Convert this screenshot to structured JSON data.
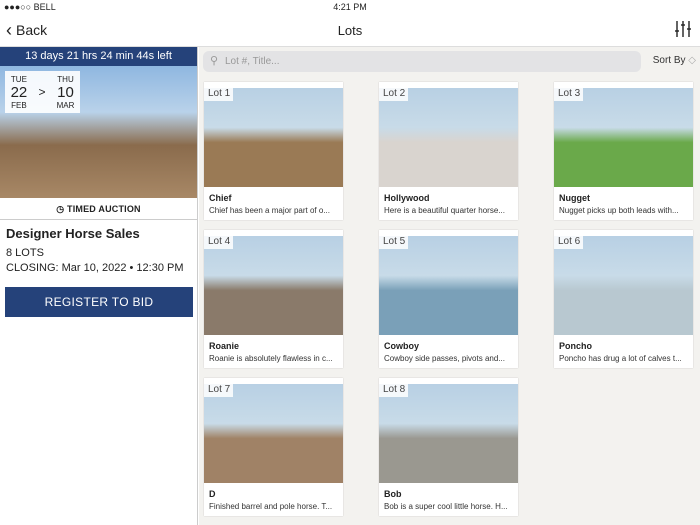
{
  "status": {
    "carrier": "●●●○○ BELL",
    "time": "4:21 PM"
  },
  "nav": {
    "back": "Back",
    "title": "Lots"
  },
  "auction": {
    "timer": "13 days 21 hrs 24 min 44s left",
    "start_day": "TUE",
    "start_date": "22",
    "start_month": "FEB",
    "sep": ">",
    "end_day": "THU",
    "end_date": "10",
    "end_month": "MAR",
    "type": "TIMED AUCTION",
    "title": "Designer Horse Sales",
    "lots": "8 LOTS",
    "closing": "CLOSING: Mar 10, 2022 • 12:30 PM",
    "register": "REGISTER TO BID"
  },
  "search": {
    "placeholder": "Lot #, Title...",
    "sort": "Sort By"
  },
  "lots": [
    {
      "lot": "Lot 1",
      "title": "Chief",
      "desc": "Chief has been a major part of o...",
      "color": "#9a7a55"
    },
    {
      "lot": "Lot 2",
      "title": "Hollywood",
      "desc": "Here is a beautiful quarter horse...",
      "color": "#d9d4cf"
    },
    {
      "lot": "Lot 3",
      "title": "Nugget",
      "desc": "Nugget picks up both leads with...",
      "color": "#6aa94a"
    },
    {
      "lot": "Lot 4",
      "title": "Roanie",
      "desc": "Roanie is absolutely flawless in c...",
      "color": "#8a7a6a"
    },
    {
      "lot": "Lot 5",
      "title": "Cowboy",
      "desc": "Cowboy side passes, pivots and...",
      "color": "#7aa0b8"
    },
    {
      "lot": "Lot 6",
      "title": "Poncho",
      "desc": "Poncho has drug a lot of calves t...",
      "color": "#b8c8d0"
    },
    {
      "lot": "Lot 7",
      "title": "D",
      "desc": "Finished barrel and pole horse. T...",
      "color": "#a08266"
    },
    {
      "lot": "Lot 8",
      "title": "Bob",
      "desc": "Bob is a super cool little horse. H...",
      "color": "#9a9890"
    }
  ]
}
